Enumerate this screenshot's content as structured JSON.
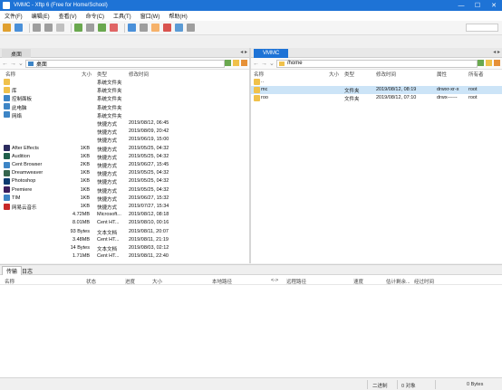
{
  "window": {
    "title": "VMMC - Xftp 6 (Free for Home/School)",
    "controls": [
      "—",
      "☐",
      "✕"
    ]
  },
  "menu": [
    "文件(F)",
    "编辑(E)",
    "查看(V)",
    "命令(C)",
    "工具(T)",
    "窗口(W)",
    "帮助(H)"
  ],
  "toolbar_icon_colors": [
    "#e0a030",
    "#4a90d9",
    "#9e9e9e",
    "#9e9e9e",
    "#c0c0c0",
    "#6aa84f",
    "#9e9e9e",
    "#6aa84f",
    "#e06666",
    "#4a90d9",
    "#9e9e9e",
    "#f6b26b",
    "#d9534f",
    "#5b9bd5",
    "#9e9e9e"
  ],
  "left_pane": {
    "tab": "桌面",
    "path": "桌面",
    "columns": {
      "name": "名称",
      "size": "大小",
      "type": "类型",
      "modified": "修改时间"
    },
    "rows": [
      {
        "name": "",
        "size": "",
        "type": "系统文件夹",
        "modified": "",
        "icon": "folder-icon",
        "color": ""
      },
      {
        "name": "库",
        "size": "",
        "type": "系统文件夹",
        "modified": "",
        "icon": "library-icon",
        "color": "#f0c14b"
      },
      {
        "name": "控制面板",
        "size": "",
        "type": "系统文件夹",
        "modified": "",
        "icon": "control-panel-icon",
        "color": "#3d85c6"
      },
      {
        "name": "此电脑",
        "size": "",
        "type": "系统文件夹",
        "modified": "",
        "icon": "computer-icon",
        "color": "#3d85c6"
      },
      {
        "name": "网络",
        "size": "",
        "type": "系统文件夹",
        "modified": "",
        "icon": "network-icon",
        "color": "#3d85c6"
      },
      {
        "name": "",
        "size": "",
        "type": "快捷方式",
        "modified": "2019/08/12, 06:45",
        "icon": "",
        "color": ""
      },
      {
        "name": "",
        "size": "",
        "type": "快捷方式",
        "modified": "2019/08/09, 20:42",
        "icon": "",
        "color": ""
      },
      {
        "name": "",
        "size": "",
        "type": "快捷方式",
        "modified": "2019/06/19, 15:00",
        "icon": "",
        "color": ""
      },
      {
        "name": "After Effects",
        "size": "1KB",
        "type": "快捷方式",
        "modified": "2019/05/25, 04:32",
        "icon": "after-effects-icon",
        "color": "#2b2b5e"
      },
      {
        "name": "Audition",
        "size": "1KB",
        "type": "快捷方式",
        "modified": "2019/05/25, 04:32",
        "icon": "audition-icon",
        "color": "#1f5e4a"
      },
      {
        "name": "Cent Browser",
        "size": "2KB",
        "type": "快捷方式",
        "modified": "2019/06/27, 15:45",
        "icon": "cent-browser-icon",
        "color": "#3d85c6"
      },
      {
        "name": "Dreamweaver",
        "size": "1KB",
        "type": "快捷方式",
        "modified": "2019/05/25, 04:32",
        "icon": "dreamweaver-icon",
        "color": "#35654d"
      },
      {
        "name": "Photoshop",
        "size": "1KB",
        "type": "快捷方式",
        "modified": "2019/05/25, 04:32",
        "icon": "photoshop-icon",
        "color": "#0b3a6e"
      },
      {
        "name": "Premiere",
        "size": "1KB",
        "type": "快捷方式",
        "modified": "2019/05/25, 04:32",
        "icon": "premiere-icon",
        "color": "#3b1f5e"
      },
      {
        "name": "TIM",
        "size": "1KB",
        "type": "快捷方式",
        "modified": "2019/06/27, 15:32",
        "icon": "tim-icon",
        "color": "#3d85c6"
      },
      {
        "name": "网易云音乐",
        "size": "1KB",
        "type": "快捷方式",
        "modified": "2019/07/27, 15:34",
        "icon": "netease-music-icon",
        "color": "#c62828"
      },
      {
        "name": "",
        "size": "4.72MB",
        "type": "Microsoft...",
        "modified": "2019/08/12, 08:18",
        "icon": "",
        "color": ""
      },
      {
        "name": "",
        "size": "8.01MB",
        "type": "Cent HT...",
        "modified": "2019/08/10, 00:16",
        "icon": "",
        "color": ""
      },
      {
        "name": "",
        "size": "93 Bytes",
        "type": "文本文档",
        "modified": "2019/08/11, 20:07",
        "icon": "",
        "color": ""
      },
      {
        "name": "",
        "size": "3.48MB",
        "type": "Cent HT...",
        "modified": "2019/08/11, 21:19",
        "icon": "",
        "color": ""
      },
      {
        "name": "",
        "size": "14 Bytes",
        "type": "文本文档",
        "modified": "2019/08/03, 02:12",
        "icon": "",
        "color": ""
      },
      {
        "name": "",
        "size": "1.71MB",
        "type": "Cent HT...",
        "modified": "2019/08/11, 22:40",
        "icon": "",
        "color": ""
      }
    ]
  },
  "right_pane": {
    "tab": "VMMC",
    "path": "/home",
    "columns": {
      "name": "名称",
      "size": "大小",
      "type": "类型",
      "modified": "修改时间",
      "attr": "属性",
      "owner": "所有者"
    },
    "rows": [
      {
        "name": "..",
        "size": "",
        "type": "",
        "modified": "",
        "attr": "",
        "owner": "",
        "selected": false
      },
      {
        "name": "mc",
        "size": "",
        "type": "文件夹",
        "modified": "2019/08/12, 08:19",
        "attr": "drwxr-xr-x",
        "owner": "root",
        "selected": true
      },
      {
        "name": "roo",
        "size": "",
        "type": "文件夹",
        "modified": "2019/08/12, 07:10",
        "attr": "drwx------",
        "owner": "root",
        "selected": false
      }
    ]
  },
  "bottom": {
    "tabs": [
      "传输",
      "日志"
    ],
    "columns": [
      "名称",
      "状态",
      "进度",
      "大小",
      "本地路径",
      "<->",
      "远程路径",
      "速度",
      "估计剩余...",
      "经过时间"
    ]
  },
  "status": {
    "mode": "二进制",
    "objects": "0 对象",
    "size": "0 Bytes"
  },
  "colors": {
    "accent": "#1e73d6",
    "selection": "#cce4f7",
    "folder": "#f0c14b"
  }
}
